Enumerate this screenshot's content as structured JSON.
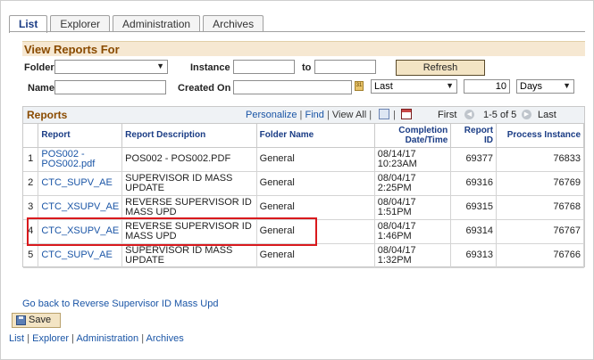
{
  "tabs": [
    "List",
    "Explorer",
    "Administration",
    "Archives"
  ],
  "view_reports": {
    "title": "View Reports For",
    "folder_label": "Folder",
    "folder_value": "",
    "instance_label": "Instance",
    "instance_from": "",
    "to_label": "to",
    "instance_to": "",
    "refresh_label": "Refresh",
    "name_label": "Name",
    "name_value": "",
    "created_on_label": "Created On",
    "created_on_value": "",
    "range_value": "Last",
    "count_value": "10",
    "unit_value": "Days"
  },
  "grid": {
    "title": "Reports",
    "personalize": "Personalize",
    "find": "Find",
    "view_all": "View All",
    "first": "First",
    "range": "1-5 of 5",
    "last": "Last",
    "columns": [
      "Report",
      "Report Description",
      "Folder Name",
      "Completion Date/Time",
      "Report ID",
      "Process Instance"
    ],
    "rows": [
      {
        "n": "1",
        "report": "POS002 - POS002.pdf",
        "desc": "POS002 - POS002.PDF",
        "folder": "General",
        "date": "08/14/17",
        "time": "10:23AM",
        "report_id": "69377",
        "instance": "76833"
      },
      {
        "n": "2",
        "report": "CTC_SUPV_AE",
        "desc": "SUPERVISOR ID MASS UPDATE",
        "folder": "General",
        "date": "08/04/17",
        "time": "2:25PM",
        "report_id": "69316",
        "instance": "76769"
      },
      {
        "n": "3",
        "report": "CTC_XSUPV_AE",
        "desc": "REVERSE SUPERVISOR ID MASS UPD",
        "folder": "General",
        "date": "08/04/17",
        "time": "1:51PM",
        "report_id": "69315",
        "instance": "76768"
      },
      {
        "n": "4",
        "report": "CTC_XSUPV_AE",
        "desc": "REVERSE SUPERVISOR ID MASS UPD",
        "folder": "General",
        "date": "08/04/17",
        "time": "1:46PM",
        "report_id": "69314",
        "instance": "76767"
      },
      {
        "n": "5",
        "report": "CTC_SUPV_AE",
        "desc": "SUPERVISOR ID MASS UPDATE",
        "folder": "General",
        "date": "08/04/17",
        "time": "1:32PM",
        "report_id": "69313",
        "instance": "76766"
      }
    ]
  },
  "go_back": "Go back to Reverse Supervisor ID Mass Upd",
  "save_label": "Save",
  "bottom_links": [
    "List",
    "Explorer",
    "Administration",
    "Archives"
  ],
  "colors": {
    "highlight": "#d9191d",
    "section_title": "#8a4b00",
    "link": "#1a55a6"
  }
}
